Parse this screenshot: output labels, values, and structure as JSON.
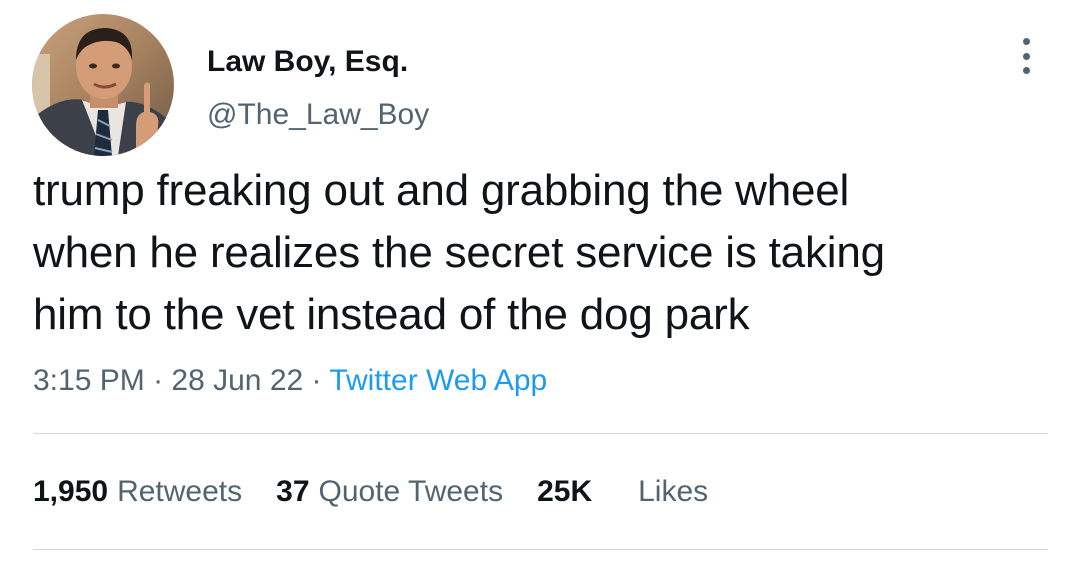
{
  "author": {
    "display_name": "Law Boy, Esq.",
    "handle": "@The_Law_Boy"
  },
  "tweet": {
    "text_lines": [
      "trump freaking out and grabbing the wheel",
      "when he realizes the secret service is taking",
      "him to the vet instead of the dog park"
    ],
    "time": "3:15 PM",
    "separator": "·",
    "date": "28 Jun 22",
    "source": "Twitter Web App"
  },
  "stats": {
    "retweets_count": "1,950",
    "retweets_label": "Retweets",
    "quotes_count": "37",
    "quotes_label": "Quote Tweets",
    "likes_count": "25K",
    "likes_label": "Likes"
  },
  "colors": {
    "text_primary": "#0f1419",
    "text_secondary": "#536471",
    "link": "#1d9bf0",
    "divider": "#cfd9de"
  },
  "icons": {
    "more": "more-horizontal-dots-icon",
    "avatar": "profile-photo"
  }
}
